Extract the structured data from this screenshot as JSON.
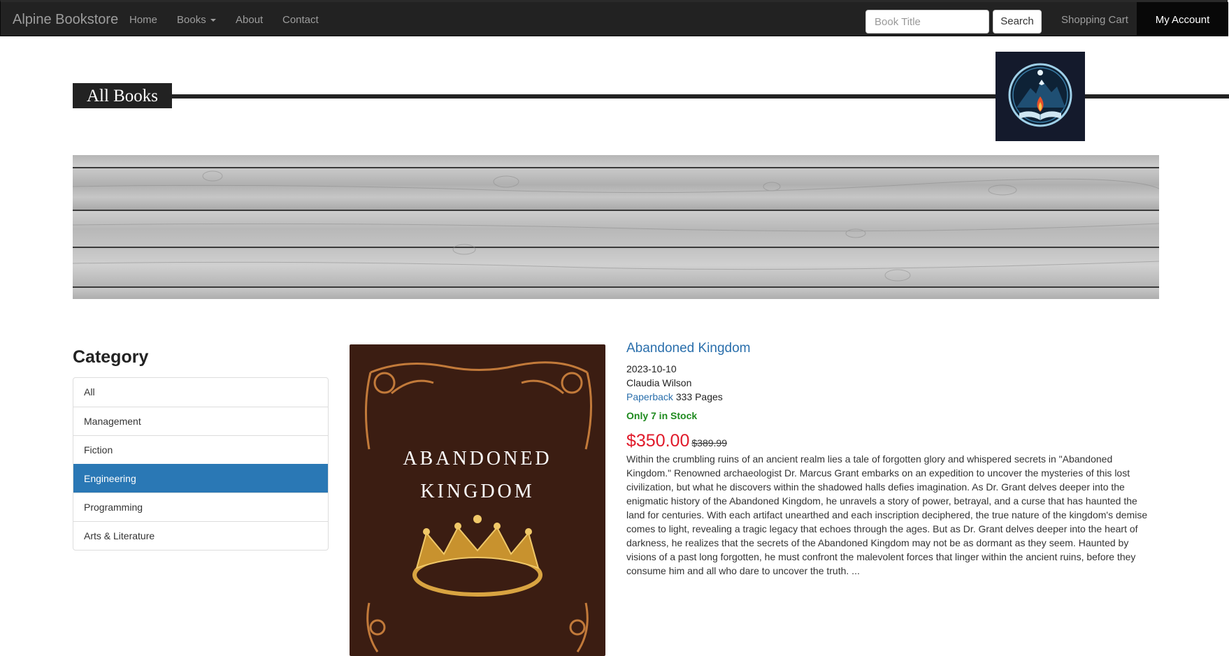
{
  "navbar": {
    "brand": "Alpine Bookstore",
    "links": [
      "Home",
      "Books",
      "About",
      "Contact"
    ],
    "search_placeholder": "Book Title",
    "search_button": "Search",
    "cart": "Shopping Cart",
    "account": "My Account"
  },
  "header": {
    "title": "All Books"
  },
  "sidebar": {
    "title": "Category",
    "items": [
      "All",
      "Management",
      "Fiction",
      "Engineering",
      "Programming",
      "Arts & Literature"
    ],
    "active": "Engineering"
  },
  "book": {
    "cover_title_line1": "ABANDONED",
    "cover_title_line2": "KINGDOM",
    "title": "Abandoned Kingdom",
    "date": "2023-10-10",
    "author": "Claudia Wilson",
    "format": "Paperback",
    "pages": "333 Pages",
    "stock": "Only 7 in Stock",
    "price": "$350.00",
    "old_price": "$389.99",
    "description": "Within the crumbling ruins of an ancient realm lies a tale of forgotten glory and whispered secrets in \"Abandoned Kingdom.\" Renowned archaeologist Dr. Marcus Grant embarks on an expedition to uncover the mysteries of this lost civilization, but what he discovers within the shadowed halls defies imagination. As Dr. Grant delves deeper into the enigmatic history of the Abandoned Kingdom, he unravels a story of power, betrayal, and a curse that has haunted the land for centuries. With each artifact unearthed and each inscription deciphered, the true nature of the kingdom's demise comes to light, revealing a tragic legacy that echoes through the ages. But as Dr. Grant delves deeper into the heart of darkness, he realizes that the secrets of the Abandoned Kingdom may not be as dormant as they seem. Haunted by visions of a past long forgotten, he must confront the malevolent forces that linger within the ancient ruins, before they consume him and all who dare to uncover the truth. ..."
  },
  "colors": {
    "navbar_bg": "#222222",
    "link_blue": "#2a6fac",
    "active_blue": "#2a78b5",
    "price_red": "#e01a2a",
    "stock_green": "#1e8a1e",
    "cover_brown": "#3b1d12"
  }
}
